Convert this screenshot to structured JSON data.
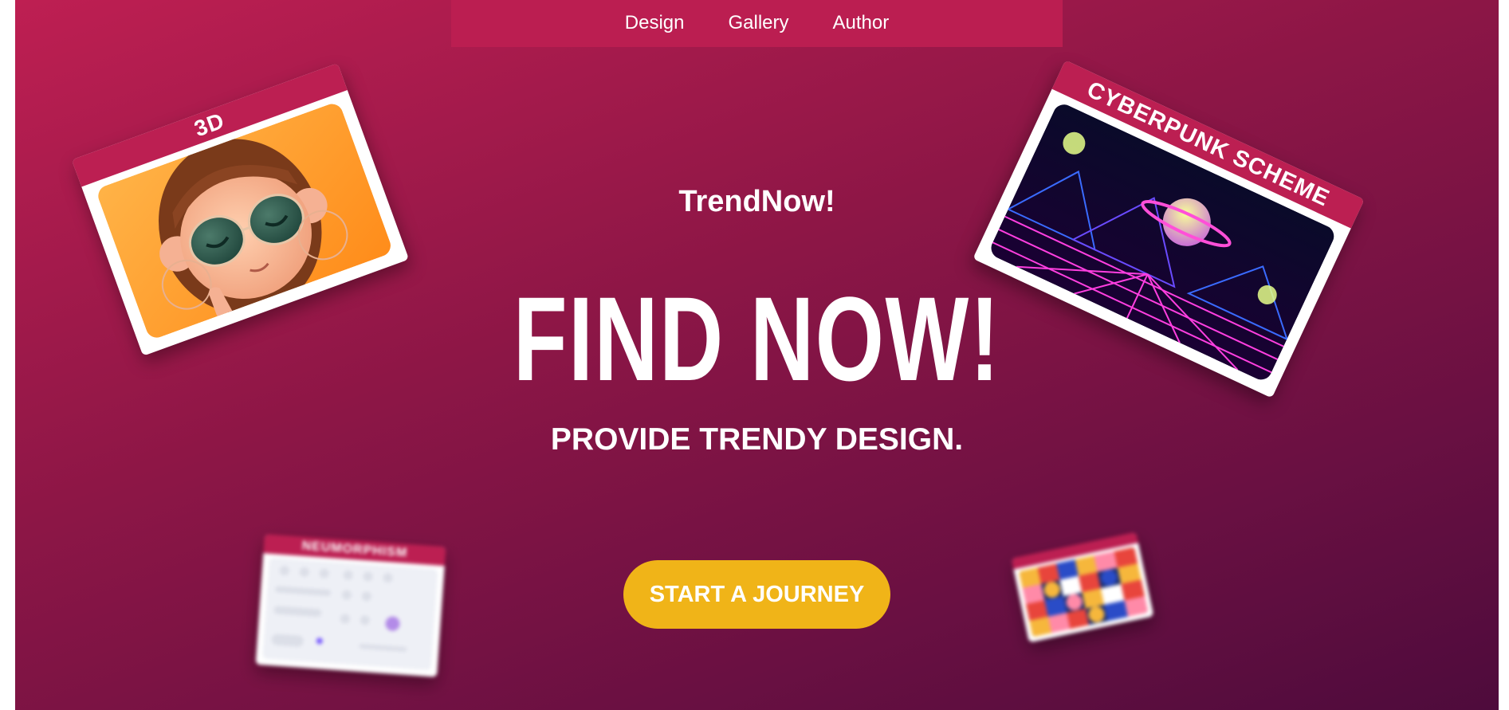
{
  "nav": {
    "items": [
      {
        "label": "Design"
      },
      {
        "label": "Gallery"
      },
      {
        "label": "Author"
      }
    ]
  },
  "hero": {
    "brand": "TrendNow!",
    "headline": "FIND NOW!",
    "tagline": "PROVIDE TRENDY DESIGN.",
    "cta_label": "START A JOURNEY"
  },
  "cards": {
    "three_d": {
      "title": "3D",
      "image": "3d-character-girl-with-sunglasses"
    },
    "cyberpunk": {
      "title": "CYBERPUNK SCHEME",
      "image": "neon-synthwave-planet-landscape"
    },
    "neumorphism": {
      "title": "NEUMORPHISM",
      "image": "neumorphic-ui-controls"
    },
    "geometric": {
      "title": "",
      "image": "colorful-geometric-pattern"
    }
  },
  "colors": {
    "gradient_start": "#be1f52",
    "gradient_end": "#4e0b3c",
    "nav_bg": "#bb1e51",
    "card_header": "#bc1f52",
    "cta_bg": "#f0b418",
    "text": "#ffffff"
  }
}
